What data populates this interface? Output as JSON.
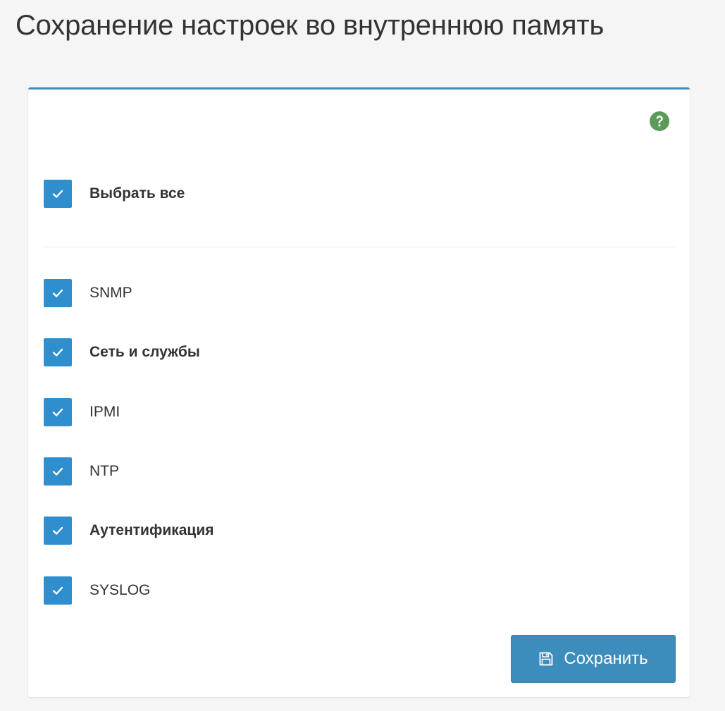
{
  "page": {
    "title": "Сохранение настроек во внутреннюю память"
  },
  "panel": {
    "accent_color": "#3c8dbc",
    "help_icon": "question-circle-icon",
    "help_icon_color": "#5b9a5b",
    "select_all": {
      "label": "Выбрать все",
      "checked": true
    },
    "items": [
      {
        "label": "SNMP",
        "checked": true
      },
      {
        "label": "Сеть и службы",
        "checked": true
      },
      {
        "label": "IPMI",
        "checked": true
      },
      {
        "label": "NTP",
        "checked": true
      },
      {
        "label": "Аутентификация",
        "checked": true
      },
      {
        "label": "SYSLOG",
        "checked": true
      }
    ],
    "checkbox_color": "#2e8ece",
    "save_button": {
      "label": "Сохранить",
      "icon": "floppy-disk-icon"
    }
  }
}
